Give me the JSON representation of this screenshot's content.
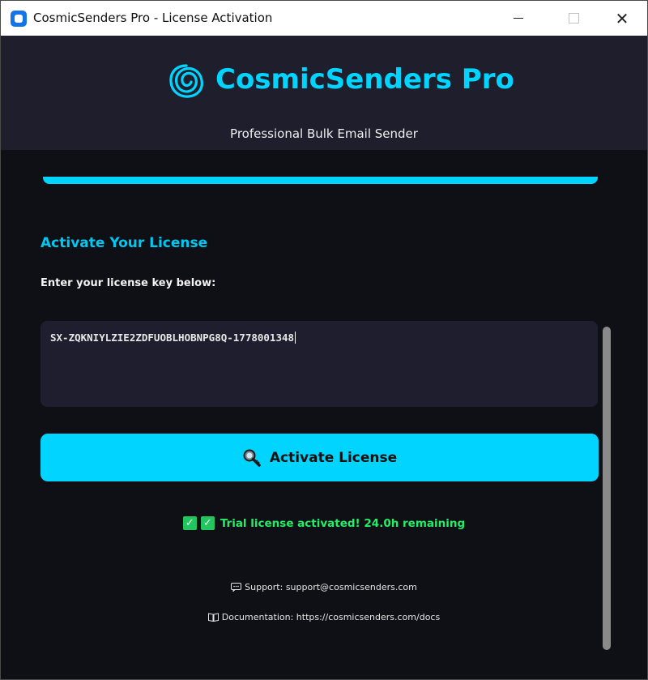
{
  "window": {
    "title": "CosmicSenders Pro - License Activation"
  },
  "header": {
    "brand": "CosmicSenders Pro",
    "tagline": "Professional Bulk Email Sender",
    "logo_icon": "spiral-logo-icon"
  },
  "activation": {
    "section_title": "Activate Your License",
    "prompt": "Enter your license key below:",
    "license_key_value": "SX-ZQKNIYLZIE2ZDFUOBLHOBNPG8Q-1778001348",
    "button_label": "Activate License",
    "button_icon": "magnifier-key-icon"
  },
  "status": {
    "icons": [
      "check-icon",
      "check-icon"
    ],
    "message": "Trial license activated! 24.0h remaining"
  },
  "footer": {
    "support_icon": "speech-bubble-icon",
    "support": "Support: support@cosmicsenders.com",
    "docs_icon": "book-icon",
    "docs": "Documentation: https://cosmicsenders.com/docs"
  },
  "colors": {
    "accent": "#00d4ff",
    "background": "#0f0f16",
    "header_bg": "#1e1e2c",
    "success": "#22ee66"
  }
}
